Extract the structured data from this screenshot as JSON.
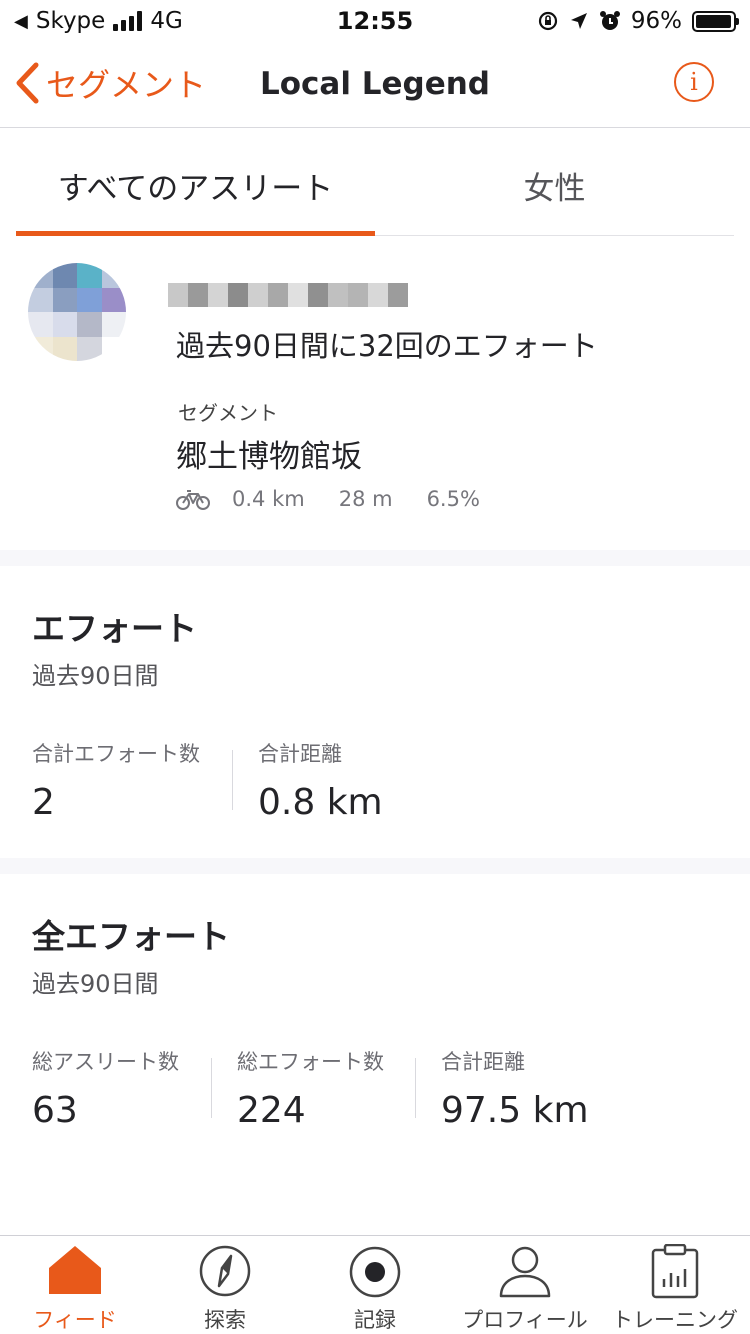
{
  "status_bar": {
    "carrier": "Skype",
    "network": "4G",
    "time": "12:55",
    "battery": "96%",
    "battery_level": 0.96
  },
  "nav": {
    "back_label": "セグメント",
    "title": "Local Legend",
    "info_icon": "info-icon"
  },
  "tabs": [
    {
      "label": "すべてのアスリート",
      "active": true
    },
    {
      "label": "女性",
      "active": false
    }
  ],
  "leader": {
    "efforts_text": "過去90日間に32回のエフォート",
    "segment_label": "セグメント",
    "segment_name": "郷土博物館坂",
    "sport_icon": "bike-icon",
    "distance": "0.4 km",
    "elevation": "28 m",
    "grade": "6.5%"
  },
  "my_efforts": {
    "title": "エフォート",
    "subtitle": "過去90日間",
    "stats": [
      {
        "label": "合計エフォート数",
        "value": "2"
      },
      {
        "label": "合計距離",
        "value": "0.8 km"
      }
    ]
  },
  "all_efforts": {
    "title": "全エフォート",
    "subtitle": "過去90日間",
    "stats": [
      {
        "label": "総アスリート数",
        "value": "63"
      },
      {
        "label": "総エフォート数",
        "value": "224"
      },
      {
        "label": "合計距離",
        "value": "97.5 km"
      }
    ]
  },
  "tab_bar": [
    {
      "label": "フィード",
      "icon": "home-icon",
      "active": true
    },
    {
      "label": "探索",
      "icon": "compass-icon",
      "active": false
    },
    {
      "label": "記録",
      "icon": "record-icon",
      "active": false
    },
    {
      "label": "プロフィール",
      "icon": "profile-icon",
      "active": false
    },
    {
      "label": "トレーニング",
      "icon": "training-icon",
      "active": false
    }
  ],
  "colors": {
    "accent": "#e8591a",
    "text": "#242428"
  }
}
